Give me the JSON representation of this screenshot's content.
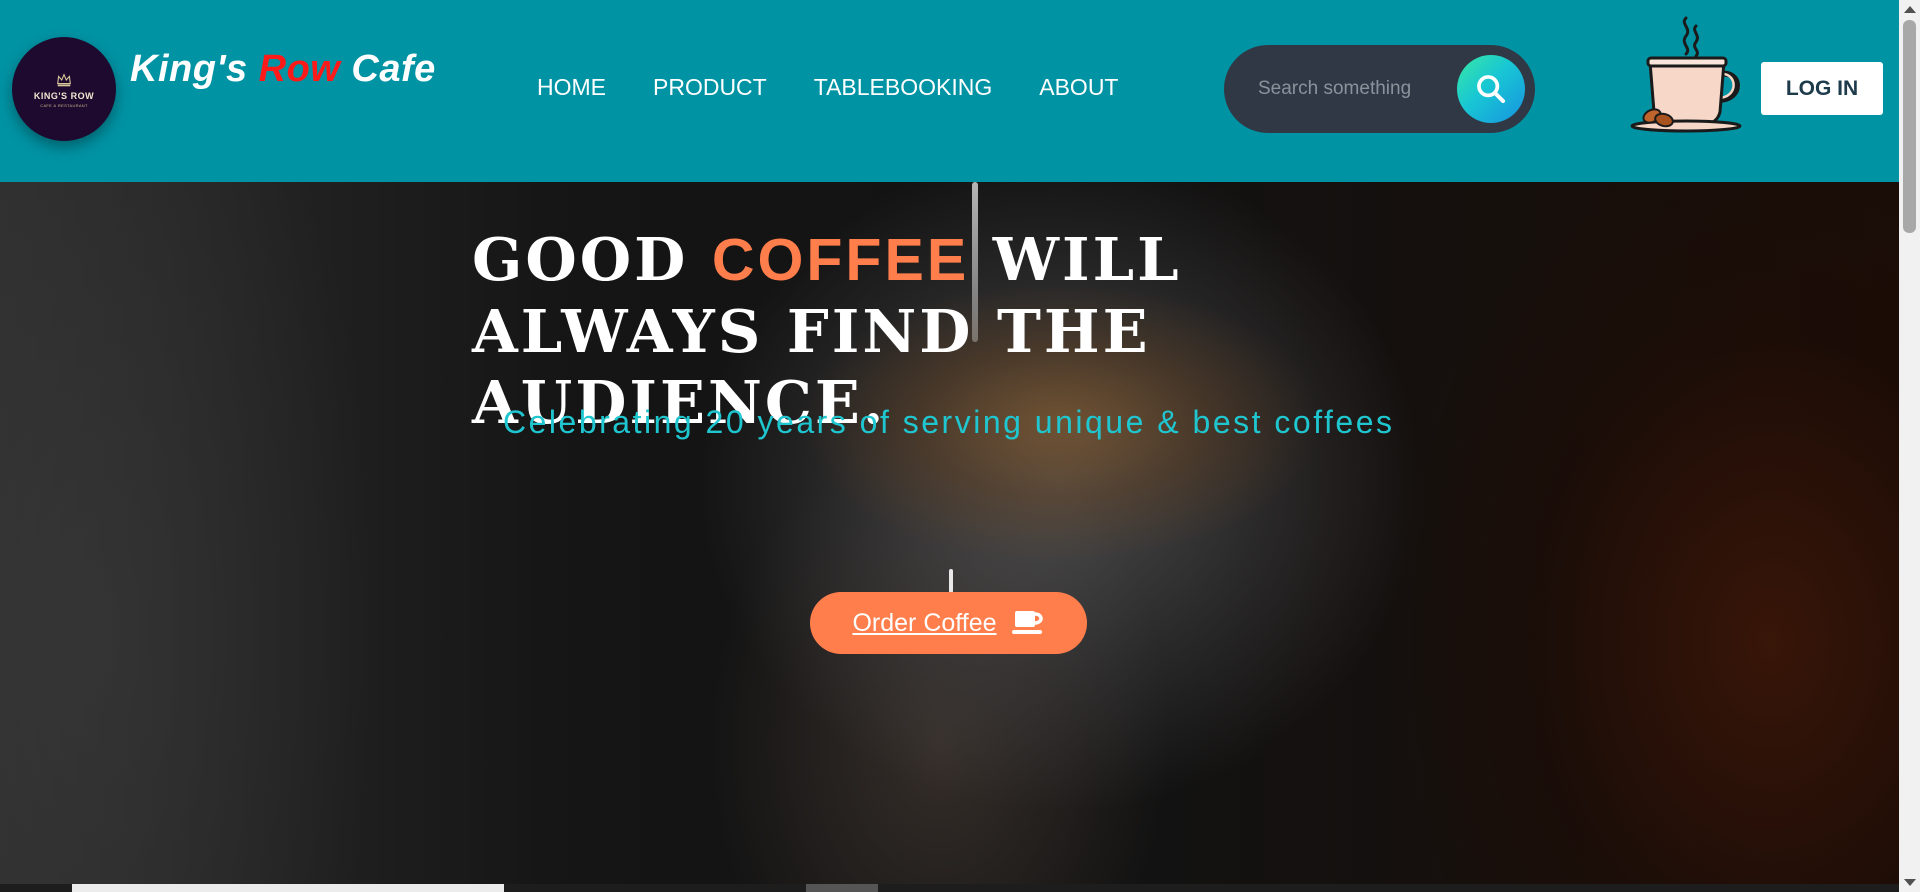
{
  "brand": {
    "logo_text": "KING'S ROW",
    "logo_subtext": "CAFE & RESTAURANT",
    "name_part1": "King's ",
    "name_accent": "Row",
    "name_part2": " Cafe",
    "accent_color": "#ff1a1a"
  },
  "nav": {
    "items": [
      {
        "label": "HOME"
      },
      {
        "label": "PRODUCT"
      },
      {
        "label": "TABLEBOOKING"
      },
      {
        "label": "ABOUT"
      }
    ]
  },
  "search": {
    "placeholder": "Search something",
    "icon": "search-icon"
  },
  "header": {
    "cart_icon": "coffee-cup-icon",
    "login_label": "LOG IN",
    "background_color": "#0093a4"
  },
  "hero": {
    "headline_part1": "GOOD ",
    "headline_accent": "COFFEE",
    "headline_part2": " WILL ALWAYS FIND THE AUDIENCE.",
    "tagline": "Celebrating 20 years of serving unique & best coffees",
    "cta_label": "Order Coffee",
    "cta_icon": "mug-icon",
    "accent_color": "#ff7e4b",
    "tagline_color": "#1fc6cf"
  }
}
